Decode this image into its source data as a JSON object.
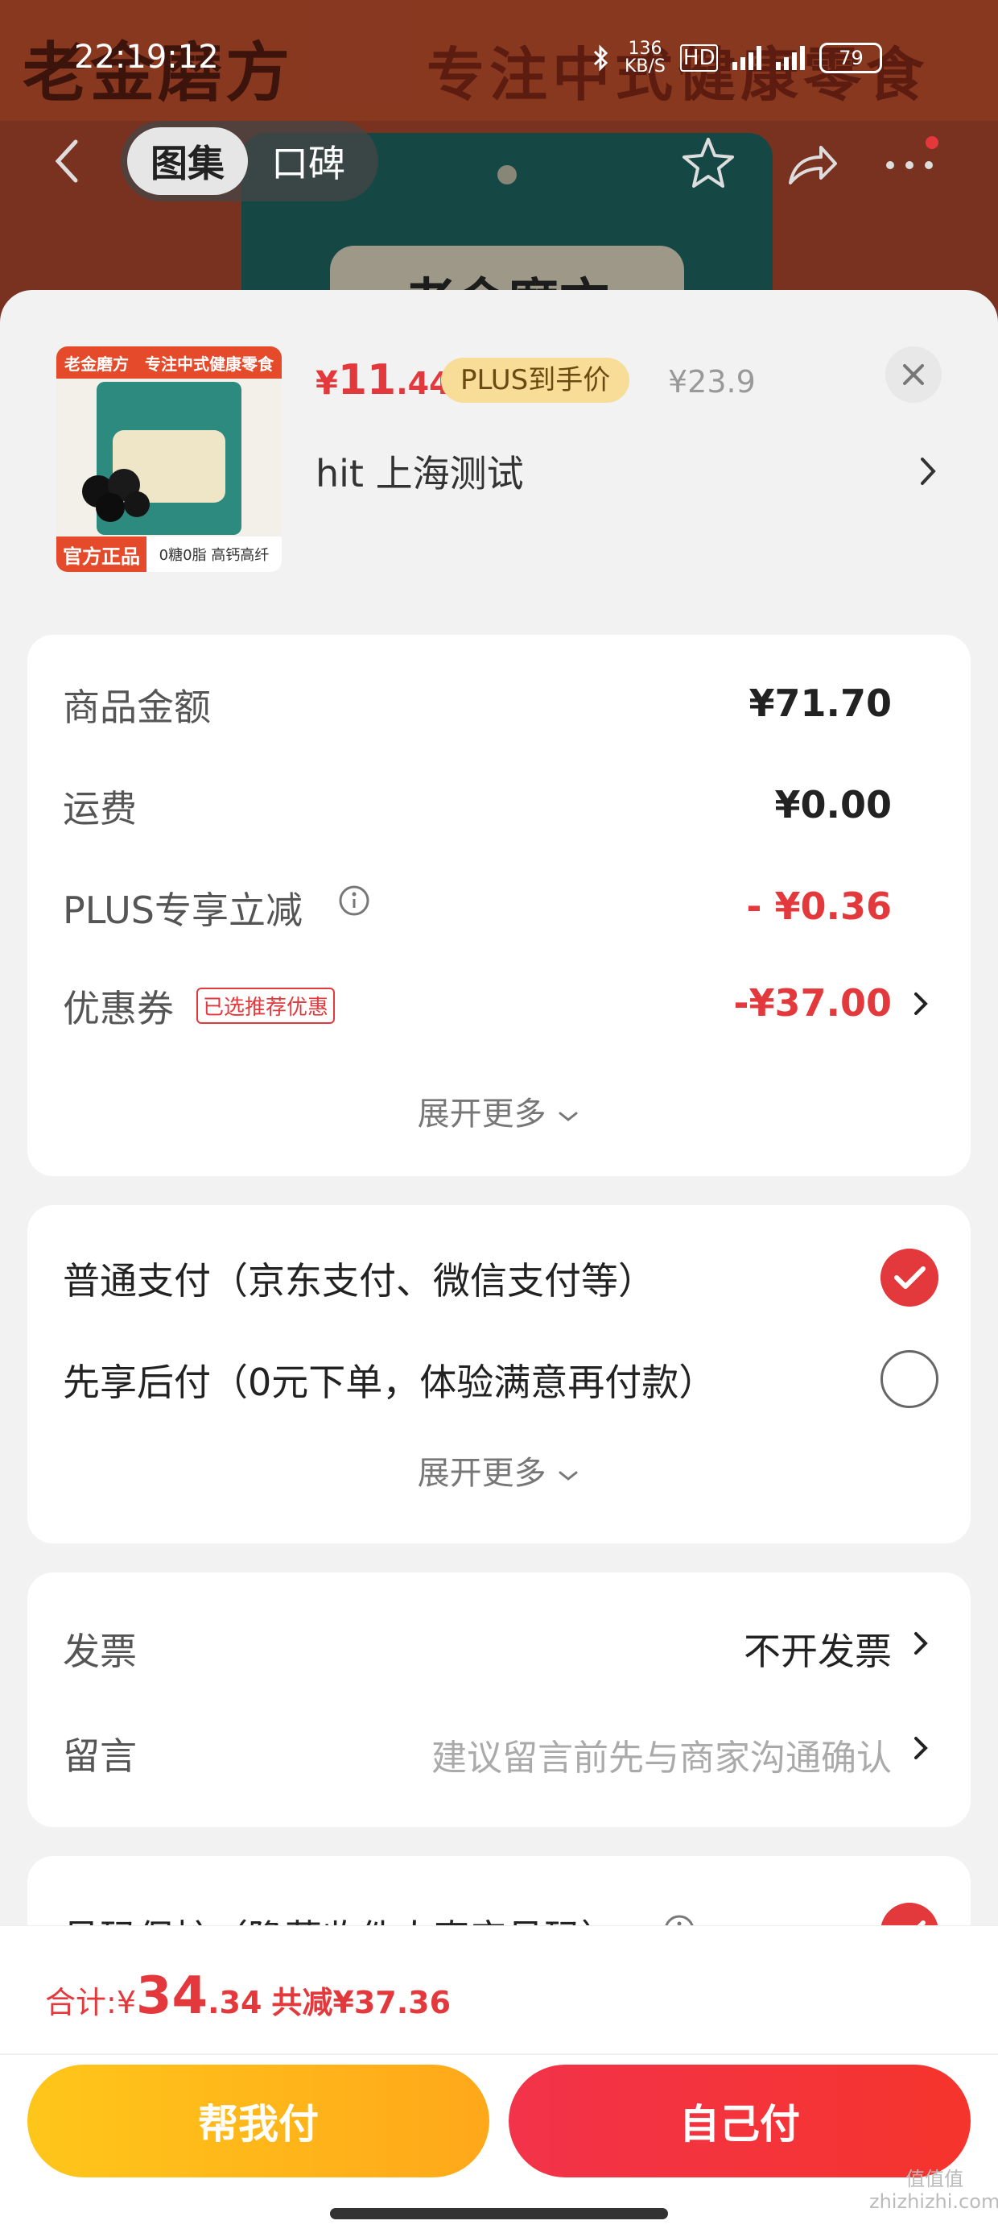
{
  "background": {
    "brand": "老金磨方",
    "slogan": "专注中式健康零食",
    "bag_label": "老金磨方"
  },
  "status_bar": {
    "time": "22:19:12",
    "net_speed_value": "136",
    "net_speed_unit": "KB/S",
    "hd": "HD",
    "battery": "79"
  },
  "nav": {
    "tabs": [
      "图集",
      "口碑"
    ]
  },
  "product": {
    "thumb_brand": "老金磨方",
    "thumb_slogan": "专注中式健康零食",
    "thumb_official": "官方正品",
    "thumb_tag": "0糖0脂 高钙高纤",
    "price_symbol": "¥",
    "price_int": "11",
    "price_dec": ".44",
    "plus_badge": "PLUS到手价",
    "price_old": "¥23.9",
    "address": "hit  上海测试"
  },
  "summary": {
    "rows": [
      {
        "label": "商品金额",
        "value": "¥71.70"
      },
      {
        "label": "运费",
        "value": "¥0.00"
      },
      {
        "label": "PLUS专享立减",
        "value": "- ¥0.36"
      },
      {
        "label": "优惠券",
        "tag": "已选推荐优惠",
        "value": "-¥37.00"
      }
    ],
    "expand": "展开更多"
  },
  "payment": {
    "options": [
      {
        "label": "普通支付（京东支付、微信支付等）",
        "selected": true
      },
      {
        "label": "先享后付（0元下单，体验满意再付款）",
        "selected": false
      }
    ],
    "expand": "展开更多"
  },
  "extras": {
    "invoice_label": "发票",
    "invoice_value": "不开发票",
    "note_label": "留言",
    "note_placeholder": "建议留言前先与商家沟通确认"
  },
  "privacy": {
    "label": "号码保护（隐藏收件人真实号码）"
  },
  "footer": {
    "total_label": "合计: ",
    "currency": "¥",
    "total_int": "34",
    "total_dec": ".34",
    "saved": "共减¥37.36",
    "helper_button": "帮我付",
    "self_button": "自己付"
  },
  "watermark": {
    "line1": "值值值",
    "line2": "zhizhizhi.com"
  },
  "colors": {
    "accent_red": "#e4393c",
    "plus_gold": "#f7dd98",
    "helper_yellow": "#ffb61a"
  }
}
